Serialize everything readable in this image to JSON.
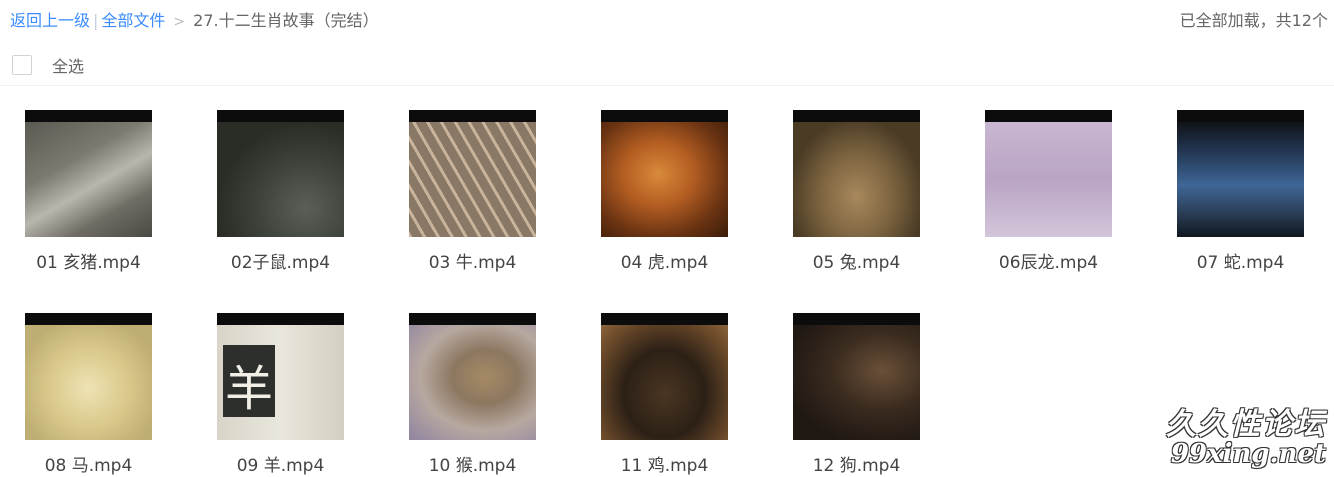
{
  "breadcrumb": {
    "back_label": "返回上一级",
    "root_label": "全部文件",
    "current_folder": "27.十二生肖故事（完结）",
    "divider": "|",
    "arrow": ">"
  },
  "status": {
    "loaded_text": "已全部加载，共12个"
  },
  "select_all": {
    "label": "全选",
    "checked": false
  },
  "files": [
    {
      "name": "01 亥猪.mp4"
    },
    {
      "name": "02子鼠.mp4"
    },
    {
      "name": "03 牛.mp4"
    },
    {
      "name": "04 虎.mp4"
    },
    {
      "name": "05 兔.mp4"
    },
    {
      "name": "06辰龙.mp4"
    },
    {
      "name": "07 蛇.mp4"
    },
    {
      "name": "08 马.mp4"
    },
    {
      "name": "09 羊.mp4"
    },
    {
      "name": "10 猴.mp4"
    },
    {
      "name": "11 鸡.mp4"
    },
    {
      "name": "12 狗.mp4"
    }
  ],
  "watermark": {
    "line1": "久久性论坛",
    "line2": "99xing.net"
  }
}
